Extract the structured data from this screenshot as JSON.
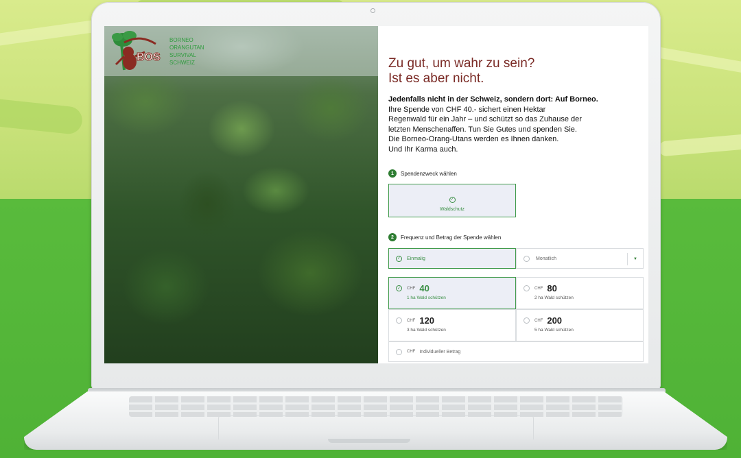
{
  "logo": {
    "mark_text": "BOS",
    "lines": [
      "BORNEO",
      "ORANGUTAN",
      "SURVIVAL",
      "SCHWEIZ"
    ]
  },
  "headline": {
    "line1": "Zu gut, um wahr zu sein?",
    "line2": "Ist es aber nicht."
  },
  "lead": {
    "bold": "Jedenfalls nicht in der Schweiz, sondern dort: Auf Borneo.",
    "lines": [
      "Ihre Spende von CHF 40.- sichert einen Hektar",
      "Regenwald für ein Jahr – und schützt so das Zuhause der",
      "letzten Menschenaffen. Tun Sie Gutes und spenden Sie.",
      "Die Borneo-Orang-Utans werden es Ihnen danken.",
      "Und Ihr Karma auch."
    ]
  },
  "step1": {
    "number": "1",
    "label": "Spendenzweck wählen"
  },
  "purpose": {
    "label": "Waldschutz",
    "selected": true
  },
  "step2": {
    "number": "2",
    "label": "Frequenz und Betrag der Spende wählen"
  },
  "frequency": {
    "options": [
      {
        "label": "Einmalig",
        "selected": true
      },
      {
        "label": "Monatlich",
        "selected": false
      }
    ]
  },
  "amounts": [
    {
      "currency": "CHF",
      "value": "40",
      "sub": "1 ha Wald schützen",
      "selected": true
    },
    {
      "currency": "CHF",
      "value": "80",
      "sub": "2 ha Wald schützen",
      "selected": false
    },
    {
      "currency": "CHF",
      "value": "120",
      "sub": "3 ha Wald schützen",
      "selected": false
    },
    {
      "currency": "CHF",
      "value": "200",
      "sub": "5 ha Wald schützen",
      "selected": false
    }
  ],
  "custom_amount": {
    "currency": "CHF",
    "placeholder": "Individueller Betrag"
  },
  "colors": {
    "brand_green": "#2e7d32",
    "headline": "#7a2a25",
    "selected_bg": "#eceef6"
  }
}
